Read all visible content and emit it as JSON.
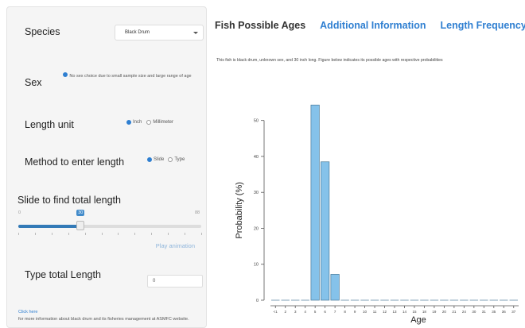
{
  "sidebar": {
    "species": {
      "label": "Species",
      "selected": "Black Drum"
    },
    "sex": {
      "label": "Sex",
      "note": "No sex choice due to small sample size and large range of age"
    },
    "length_unit": {
      "label": "Length unit",
      "options": [
        "Inch",
        "Millimeter"
      ],
      "selected": "Inch"
    },
    "method": {
      "label": "Method to enter length",
      "options": [
        "Slide",
        "Type"
      ],
      "selected": "Slide"
    },
    "slider": {
      "label": "Slide to find total length",
      "min": "0",
      "max": "88",
      "value": "30",
      "value_fraction": 0.34,
      "play": "Play animation"
    },
    "type_length": {
      "label": "Type total Length",
      "value": "0"
    },
    "footer": {
      "link": "Click here",
      "text": "for more information about black drum and its fisheries management at ASMFC website."
    }
  },
  "tabs": [
    "Fish Possible Ages",
    "Additional Information",
    "Length Frequency"
  ],
  "active_tab": 0,
  "description": "This fish is black drum, unknown sex, and 30 inch long. Figure below indicates its possible ages with respective probabilities",
  "colors": {
    "accent": "#2f7fd1",
    "bar": "#85c2ea",
    "bar_stroke": "#4a7a99"
  },
  "chart_data": {
    "type": "bar",
    "xlabel": "Age",
    "ylabel": "Probability (%)",
    "yticks": [
      0,
      10,
      20,
      30,
      40,
      50
    ],
    "ylim": [
      0,
      57
    ],
    "categories": [
      "<1",
      "2",
      "3",
      "4",
      "5",
      "6",
      "7",
      "8",
      "9",
      "10",
      "11",
      "12",
      "13",
      "14",
      "15",
      "18",
      "19",
      "20",
      "21",
      "24",
      "30",
      "31",
      "35",
      "36",
      "37"
    ],
    "values": [
      0,
      0,
      0,
      0,
      54.3,
      38.5,
      7.2,
      0,
      0,
      0,
      0,
      0,
      0,
      0,
      0,
      0,
      0,
      0,
      0,
      0,
      0,
      0,
      0,
      0,
      0
    ]
  }
}
